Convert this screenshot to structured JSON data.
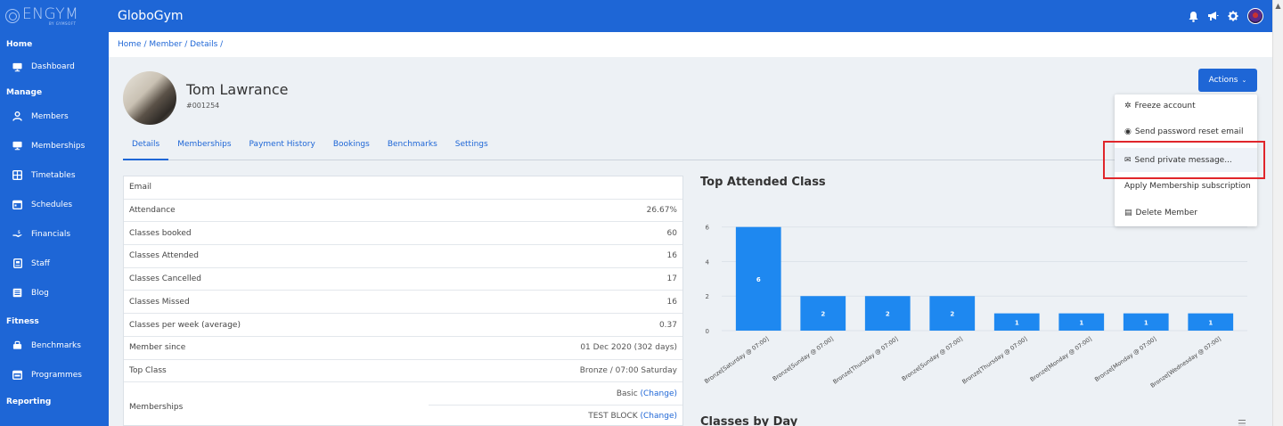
{
  "brand": {
    "name": "ENGYM",
    "sub": "BY GYMSOFT"
  },
  "topbar": {
    "app_name": "GloboGym"
  },
  "icons": {
    "bell": "bell-icon",
    "megaphone": "megaphone-icon",
    "settings": "gear-icon"
  },
  "breadcrumb": "Home / Member / Details /",
  "sidebar": {
    "sections": [
      "Home",
      "Manage",
      "Fitness",
      "Reporting"
    ],
    "items": [
      {
        "label": "Dashboard",
        "icon": "monitor-icon"
      },
      {
        "label": "Members",
        "icon": "user-icon"
      },
      {
        "label": "Memberships",
        "icon": "monitor-icon"
      },
      {
        "label": "Timetables",
        "icon": "grid-icon"
      },
      {
        "label": "Schedules",
        "icon": "calendar-icon"
      },
      {
        "label": "Financials",
        "icon": "hand-dollar-icon"
      },
      {
        "label": "Staff",
        "icon": "badge-icon"
      },
      {
        "label": "Blog",
        "icon": "newspaper-icon"
      },
      {
        "label": "Benchmarks",
        "icon": "dumbbell-icon"
      },
      {
        "label": "Programmes",
        "icon": "calendar-icon"
      }
    ]
  },
  "profile": {
    "name": "Tom Lawrance",
    "id": "#001254"
  },
  "tabs": [
    "Details",
    "Memberships",
    "Payment History",
    "Bookings",
    "Benchmarks",
    "Settings"
  ],
  "actions": {
    "label": "Actions",
    "menu": [
      {
        "label": "Freeze account",
        "icon": "snowflake-icon"
      },
      {
        "label": "Send password reset email",
        "icon": "at-icon"
      },
      {
        "label": "Send private message...",
        "icon": "envelope-icon"
      },
      {
        "label": "Apply Membership subscription",
        "icon": ""
      },
      {
        "label": "Delete Member",
        "icon": "trash-icon"
      }
    ]
  },
  "details": [
    {
      "label": "Email",
      "value": ""
    },
    {
      "label": "Attendance",
      "value": "26.67%"
    },
    {
      "label": "Classes booked",
      "value": "60"
    },
    {
      "label": "Classes Attended",
      "value": "16"
    },
    {
      "label": "Classes Cancelled",
      "value": "17"
    },
    {
      "label": "Classes Missed",
      "value": "16"
    },
    {
      "label": "Classes per week (average)",
      "value": "0.37"
    },
    {
      "label": "Member since",
      "value": "01 Dec 2020 (302 days)"
    },
    {
      "label": "Top Class",
      "value": "Bronze / 07:00 Saturday"
    }
  ],
  "memberships": {
    "label": "Memberships",
    "change_label": "(Change)",
    "items": [
      "Basic",
      "TEST BLOCK"
    ]
  },
  "chart_data": {
    "type": "bar",
    "title": "Top Attended Class",
    "categories": [
      "Bronze[Saturday @ 07:00]",
      "Bronze[Sunday @ 07:00]",
      "Bronze[Thursday @ 07:00]",
      "Bronze[Sunday @ 07:00]",
      "Bronze[Thursday @ 07:00]",
      "Bronze[Monday @ 07:00]",
      "Bronze[Monday @ 07:00]",
      "Bronze[Wednesday @ 07:00]"
    ],
    "values": [
      6,
      2,
      2,
      2,
      1,
      1,
      1,
      1
    ],
    "yticks": [
      0,
      2,
      4,
      6
    ],
    "ylim": [
      0,
      6.5
    ],
    "grid": true,
    "color": "#1e88f0"
  },
  "chart2": {
    "title": "Classes by Day"
  }
}
